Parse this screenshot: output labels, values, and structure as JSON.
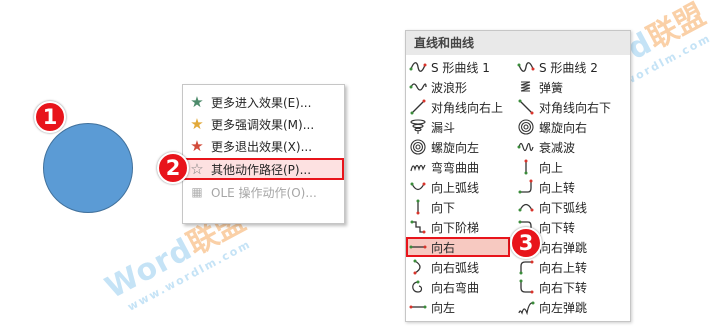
{
  "badges": [
    "1",
    "2",
    "3"
  ],
  "context_menu": {
    "items": [
      {
        "label": "更多进入效果(E)...",
        "icon": "star-green-icon",
        "color": "#4d8b6b"
      },
      {
        "label": "更多强调效果(M)...",
        "icon": "star-gold-icon",
        "color": "#e2a93a"
      },
      {
        "label": "更多退出效果(X)...",
        "icon": "star-red-icon",
        "color": "#d24b3a"
      },
      {
        "label": "其他动作路径(P)...",
        "icon": "star-outline-icon",
        "color": "#7f7f7f",
        "highlighted": true
      },
      {
        "label": "OLE 操作动作(O)...",
        "icon": "ole-icon",
        "color": "#b0b0b0",
        "disabled": true
      }
    ]
  },
  "panel": {
    "title": "直线和曲线",
    "items": [
      {
        "label": "S 形曲线 1",
        "icon": "s-curve-1-icon"
      },
      {
        "label": "S 形曲线 2",
        "icon": "s-curve-2-icon"
      },
      {
        "label": "波浪形",
        "icon": "wave-icon"
      },
      {
        "label": "弹簧",
        "icon": "spring-icon"
      },
      {
        "label": "对角线向右上",
        "icon": "diagonal-up-right-icon"
      },
      {
        "label": "对角线向右下",
        "icon": "diagonal-down-right-icon"
      },
      {
        "label": "漏斗",
        "icon": "funnel-icon"
      },
      {
        "label": "螺旋向右",
        "icon": "spiral-right-icon"
      },
      {
        "label": "螺旋向左",
        "icon": "spiral-left-icon"
      },
      {
        "label": "衰减波",
        "icon": "decaying-wave-icon"
      },
      {
        "label": "弯弯曲曲",
        "icon": "zigzag-curve-icon"
      },
      {
        "label": "向上",
        "icon": "up-icon"
      },
      {
        "label": "向上弧线",
        "icon": "arc-up-icon"
      },
      {
        "label": "向上转",
        "icon": "turn-up-icon"
      },
      {
        "label": "向下",
        "icon": "down-icon"
      },
      {
        "label": "向下弧线",
        "icon": "arc-down-icon"
      },
      {
        "label": "向下阶梯",
        "icon": "stairs-down-icon"
      },
      {
        "label": "向下转",
        "icon": "turn-down-icon"
      },
      {
        "label": "向右",
        "icon": "right-icon",
        "highlighted": true
      },
      {
        "label": "向右弹跳",
        "icon": "bounce-right-icon"
      },
      {
        "label": "向右弧线",
        "icon": "arc-right-icon"
      },
      {
        "label": "向右上转",
        "icon": "turn-up-right-icon"
      },
      {
        "label": "向右弯曲",
        "icon": "curvy-right-icon"
      },
      {
        "label": "向右下转",
        "icon": "turn-down-right-icon"
      },
      {
        "label": "向左",
        "icon": "left-icon"
      },
      {
        "label": "向左弹跳",
        "icon": "bounce-left-icon"
      }
    ]
  },
  "watermark": {
    "brand": "Word",
    "brand_cn": "联盟",
    "url": "www.wordlm.com"
  },
  "colors": {
    "accent_red": "#e8141b",
    "shape_fill": "#5b9bd5",
    "path_green": "#3a8c3a",
    "path_red": "#d9342b"
  }
}
